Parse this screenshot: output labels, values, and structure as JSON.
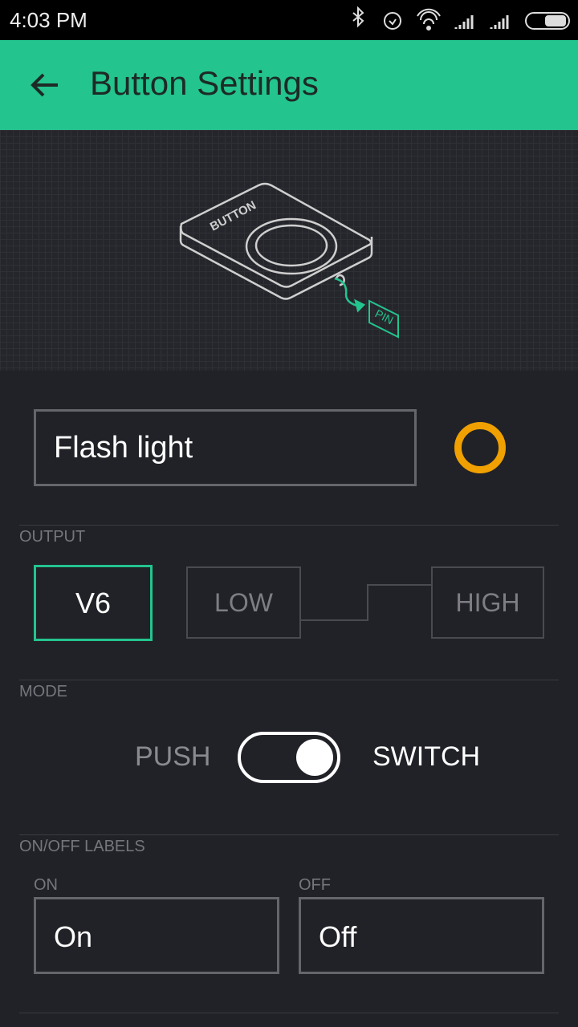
{
  "status_bar": {
    "time": "4:03 PM",
    "icons": [
      "bluetooth-icon",
      "alarm-icon",
      "wifi-icon",
      "signal-icon",
      "signal-icon",
      "battery-icon"
    ]
  },
  "app_bar": {
    "title": "Button Settings",
    "back_icon": "arrow-left-icon",
    "color": "#23c48e"
  },
  "illustration": {
    "device_label": "BUTTON",
    "pin_label": "PIN"
  },
  "name_field": {
    "value": "Flash light",
    "color_swatch": "#f0a000"
  },
  "output": {
    "section_label": "OUTPUT",
    "pin": "V6",
    "low": "LOW",
    "high": "HIGH"
  },
  "mode": {
    "section_label": "MODE",
    "left": "PUSH",
    "right": "SWITCH",
    "selected": "SWITCH"
  },
  "labels": {
    "section_label": "ON/OFF LABELS",
    "on_label": "ON",
    "on_value": "On",
    "off_label": "OFF",
    "off_value": "Off"
  }
}
